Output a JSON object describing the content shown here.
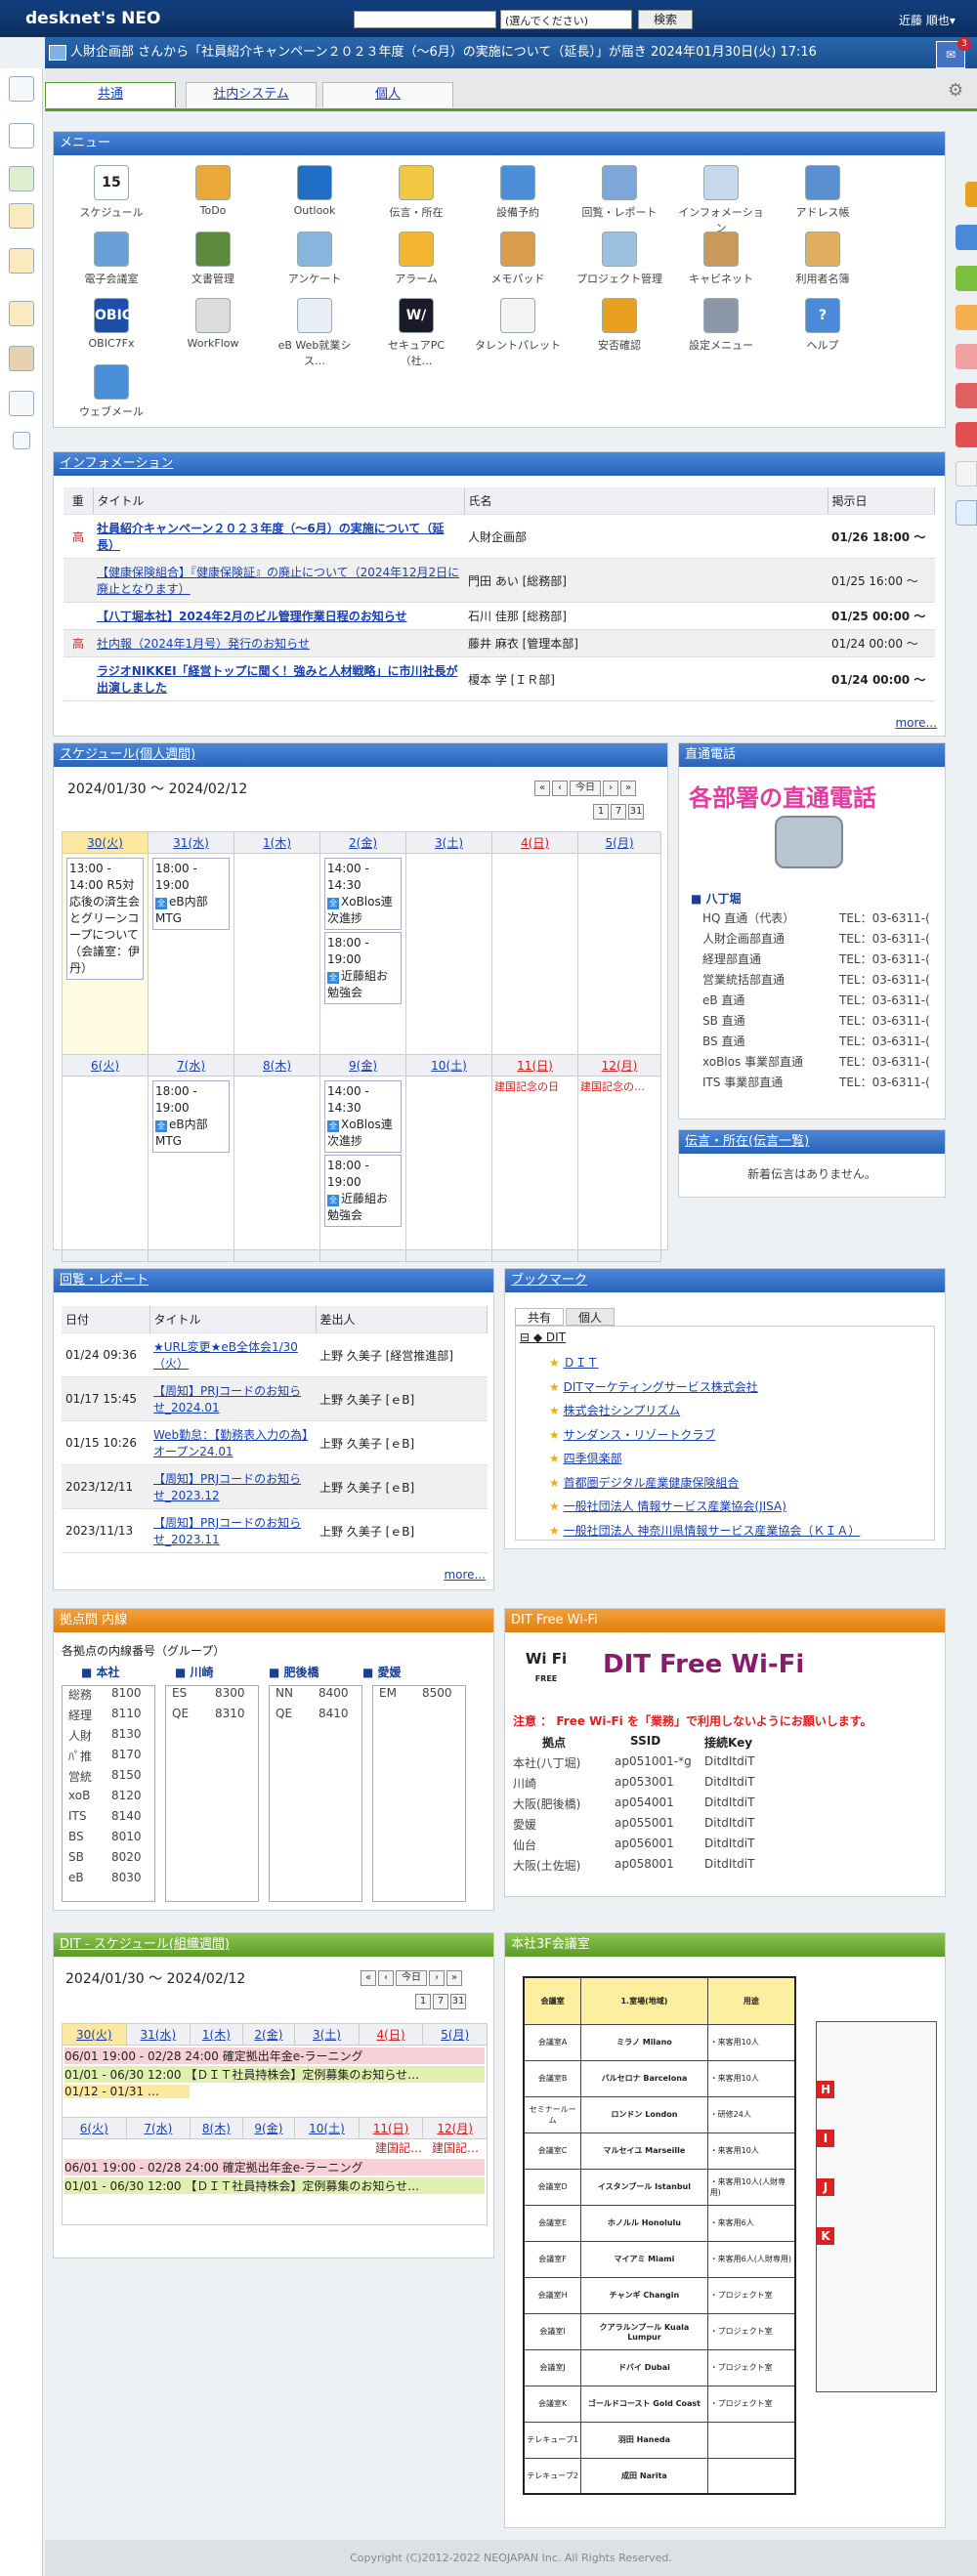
{
  "header": {
    "logo": "desknet's NEO",
    "select": "(選んでください)",
    "search": "検索",
    "user": "近藤 順也▾",
    "notice": "人財企画部 さんから「社員紹介キャンペーン２０２３年度（～6月）の実施について（延長）」が届き 2024年01月30日(火) 17:16",
    "badge": "3"
  },
  "tabs": [
    "共通",
    "社内システム",
    "個人"
  ],
  "menu": {
    "title": "メニュー",
    "items": [
      {
        "label": "スケジュール",
        "color": "#ffffff",
        "extra": "15"
      },
      {
        "label": "ToDo",
        "color": "#e8a93a"
      },
      {
        "label": "Outlook",
        "color": "#1f6fc7"
      },
      {
        "label": "伝言・所在",
        "color": "#f2c744"
      },
      {
        "label": "設備予約",
        "color": "#4c8fd8"
      },
      {
        "label": "回覧・レポート",
        "color": "#7ea6d8"
      },
      {
        "label": "インフォメーション",
        "color": "#c8d8ec"
      },
      {
        "label": "アドレス帳",
        "color": "#5a8fd0"
      },
      {
        "label": "電子会議室",
        "color": "#6aa0d8"
      },
      {
        "label": "文書管理",
        "color": "#5a8a3a"
      },
      {
        "label": "アンケート",
        "color": "#8ab4e0"
      },
      {
        "label": "アラーム",
        "color": "#f2b632"
      },
      {
        "label": "メモパッド",
        "color": "#d89c4a"
      },
      {
        "label": "プロジェクト管理",
        "color": "#9ec0e0"
      },
      {
        "label": "キャビネット",
        "color": "#c89a5a"
      },
      {
        "label": "利用者名簿",
        "color": "#e0b060"
      },
      {
        "label": "OBIC7Fx",
        "color": "#1e4fa8",
        "extra": "OBIC7"
      },
      {
        "label": "WorkFlow",
        "color": "#dddddd"
      },
      {
        "label": "eB Web就業シス…",
        "color": "#e8eef6"
      },
      {
        "label": "セキュアPC（社…",
        "color": "#1a1a2a",
        "extra": "W/"
      },
      {
        "label": "タレントパレット",
        "color": "#f4f4f4"
      },
      {
        "label": "安否確認",
        "color": "#e8a020"
      },
      {
        "label": "設定メニュー",
        "color": "#8a98a8"
      },
      {
        "label": "ヘルプ",
        "color": "#4a8ad8",
        "extra": "?"
      },
      {
        "label": "ウェブメール",
        "color": "#4a90d8"
      }
    ]
  },
  "info": {
    "title": "インフォメーション",
    "cols": [
      "重",
      "タイトル",
      "氏名",
      "掲示日"
    ],
    "rows": [
      {
        "p": "高",
        "t": "社員紹介キャンペーン２０２３年度（～6月）の実施について（延長）",
        "n": "人財企画部",
        "d": "01/26 18:00 ～",
        "bold": true
      },
      {
        "p": "",
        "t": "【健康保険組合】『健康保険証』の廃止について（2024年12月2日に廃止となります）",
        "n": "門田 あい [総務部]",
        "d": "01/25 16:00 ～",
        "bold": false
      },
      {
        "p": "",
        "t": "【八丁堀本社】2024年2月のビル管理作業日程のお知らせ",
        "n": "石川 佳那 [総務部]",
        "d": "01/25 00:00 ～",
        "bold": true
      },
      {
        "p": "高",
        "t": "社内報（2024年1月号）発行のお知らせ",
        "n": "藤井 麻衣 [管理本部]",
        "d": "01/24 00:00 ～",
        "bold": false
      },
      {
        "p": "",
        "t": "ラジオNIKKEI「経営トップに聞く！強みと人材戦略」に市川社長が出演しました",
        "n": "榎本 学 [ＩＲ部]",
        "d": "01/24 00:00 ～",
        "bold": true
      }
    ],
    "more": "more..."
  },
  "sched": {
    "title": "スケジュール(個人週間)",
    "range": "2024/01/30 ～ 2024/02/12",
    "today": "今日",
    "w1": [
      "30(火)",
      "31(水)",
      "1(木)",
      "2(金)",
      "3(土)",
      "4(日)",
      "5(月)"
    ],
    "w2": [
      "6(火)",
      "7(水)",
      "8(木)",
      "9(金)",
      "10(土)",
      "11(日)",
      "12(月)"
    ],
    "e1a": "13:00 - 14:00 R5対応後の済生会とグリーンコープについて（会議室：伊丹）",
    "e1b": "18:00 - 19:00",
    "e1b2": "eB内部MTG",
    "e1c": "14:00 - 14:30",
    "e1c2": "XoBlos連次進捗",
    "e1d": "18:00 - 19:00",
    "e1d2": "近藤組お勉強会",
    "e2b": "18:00 - 19:00",
    "e2b2": "eB内部MTG",
    "e2c": "14:00 - 14:30",
    "e2c2": "XoBlos連次進捗",
    "e2d": "18:00 - 19:00",
    "e2d2": "近藤組お勉強会",
    "h1": "建国記念の日",
    "h2": "建国記念の…"
  },
  "phone": {
    "title": "直通電話",
    "head": "各部署の直通電話",
    "site": "■ 八丁堀",
    "rows": [
      [
        "HQ 直通（代表）",
        "TEL：03-6311-("
      ],
      [
        "人財企画部直通",
        "TEL：03-6311-("
      ],
      [
        "経理部直通",
        "TEL：03-6311-("
      ],
      [
        "営業統括部直通",
        "TEL：03-6311-("
      ],
      [
        "eB 直通",
        "TEL：03-6311-("
      ],
      [
        "SB 直通",
        "TEL：03-6311-("
      ],
      [
        "BS 直通",
        "TEL：03-6311-("
      ],
      [
        "xoBlos 事業部直通",
        "TEL：03-6311-("
      ],
      [
        "ITS 事業部直通",
        "TEL：03-6311-("
      ]
    ]
  },
  "msg": {
    "title": "伝言・所在(伝言一覧)",
    "body": "新着伝言はありません。"
  },
  "circ": {
    "title": "回覧・レポート",
    "cols": [
      "日付",
      "タイトル",
      "差出人"
    ],
    "rows": [
      [
        "01/24 09:36",
        "★URL変更★eB全体会1/30（火）",
        "上野 久美子 [経営推進部]"
      ],
      [
        "01/17 15:45",
        "【周知】PRJコードのお知らせ_2024.01",
        "上野 久美子 [ｅB]"
      ],
      [
        "01/15 10:26",
        "Web勤怠：【勤務表入力の為】オープン24.01",
        "上野 久美子 [ｅB]"
      ],
      [
        "2023/12/11",
        "【周知】PRJコードのお知らせ_2023.12",
        "上野 久美子 [ｅB]"
      ],
      [
        "2023/11/13",
        "【周知】PRJコードのお知らせ_2023.11",
        "上野 久美子 [ｅB]"
      ]
    ],
    "more": "more..."
  },
  "bm": {
    "title": "ブックマーク",
    "tabs": [
      "共有",
      "個人"
    ],
    "root": "DIT",
    "items": [
      "ＤＩＴ",
      "DITマーケティングサービス株式会社",
      "株式会社シンプリズム",
      "サンダンス・リゾートクラブ",
      "四季倶楽部",
      "首都圏デジタル産業健康保険組合",
      "一般社団法人 情報サービス産業協会(JISA)",
      "一般社団法人 神奈川県情報サービス産業協会（ＫＩＡ）"
    ]
  },
  "ext": {
    "title": "拠点間 内線",
    "sub": "各拠点の内線番号（グループ）",
    "sites": [
      "■ 本社",
      "■ 川崎",
      "■ 肥後橋",
      "■ 愛媛"
    ],
    "c1": [
      [
        "総務",
        "8100"
      ],
      [
        "経理",
        "8110"
      ],
      [
        "人財",
        "8130"
      ],
      [
        "ﾊﾟ推",
        "8170"
      ],
      [
        "営統",
        "8150"
      ],
      [
        "xoB",
        "8120"
      ],
      [
        "ITS",
        "8140"
      ],
      [
        "BS",
        "8010"
      ],
      [
        "SB",
        "8020"
      ],
      [
        "eB",
        "8030"
      ]
    ],
    "c2": [
      [
        "ES",
        "8300"
      ],
      [
        "QE",
        "8310"
      ]
    ],
    "c3": [
      [
        "NN",
        "8400"
      ],
      [
        "QE",
        "8410"
      ]
    ],
    "c4": [
      [
        "EM",
        "8500"
      ]
    ]
  },
  "wifi": {
    "title": "DIT Free Wi-Fi",
    "head": "DIT Free Wi-Fi",
    "logo": "Wi Fi",
    "logo2": "FREE",
    "warn": "注意 ： Free Wi-Fi を「業務」で利用しないようにお願いします。",
    "cols": [
      "拠点",
      "SSID",
      "接続Key"
    ],
    "rows": [
      [
        "本社(八丁堀)",
        "ap051001-*g",
        "DitdItdiT"
      ],
      [
        "川崎",
        "ap053001",
        "DitdItdiT"
      ],
      [
        "大阪(肥後橋)",
        "ap054001",
        "DitdItdiT"
      ],
      [
        "愛媛",
        "ap055001",
        "DitdItdiT"
      ],
      [
        "仙台",
        "ap056001",
        "DitdItdiT"
      ],
      [
        "大阪(土佐堀)",
        "ap058001",
        "DitdItdiT"
      ]
    ]
  },
  "org": {
    "title": "DIT - スケジュール(組織週間)",
    "range": "2024/01/30 ～ 2024/02/12",
    "today": "今日",
    "w1": [
      "30(火)",
      "31(水)",
      "1(木)",
      "2(金)",
      "3(土)",
      "4(日)",
      "5(月)"
    ],
    "w2": [
      "6(火)",
      "7(水)",
      "8(木)",
      "9(金)",
      "10(土)",
      "11(日)",
      "12(月)"
    ],
    "b1": "06/01 19:00 - 02/28 24:00 確定拠出年金e-ラーニング",
    "b2": "01/01 - 06/30 12:00 【ＤＩＴ社員持株会】定例募集のお知らせ…",
    "b3": "01/12 - 01/31 …",
    "h1": "建国記…",
    "h2": "建国記…"
  },
  "room": {
    "title": "本社3F会議室",
    "cols": [
      "会議室",
      "1.室場(地域)",
      "用途"
    ],
    "rows": [
      [
        "会議室A",
        "ミラノ Milano",
        "・来客用10人"
      ],
      [
        "会議室B",
        "バルセロナ Barcelona",
        "・来客用10人"
      ],
      [
        "セミナールーム",
        "ロンドン London",
        "・研修24人"
      ],
      [
        "会議室C",
        "マルセイユ Marseille",
        "・来客用10人"
      ],
      [
        "会議室D",
        "イスタンブール Istanbul",
        "・来客用10人(人財専用)"
      ],
      [
        "会議室E",
        "ホノルル Honolulu",
        "・来客用6人"
      ],
      [
        "会議室F",
        "マイアミ Miami",
        "・来客用6人(人財専用)"
      ],
      [
        "会議室H",
        "チャンギ Changin",
        "・プロジェクト室"
      ],
      [
        "会議室I",
        "クアラルンプール Kuala Lumpur",
        "・プロジェクト室"
      ],
      [
        "会議室J",
        "ドバイ Dubai",
        "・プロジェクト室"
      ],
      [
        "会議室K",
        "ゴールドコースト Gold Coast",
        "・プロジェクト室"
      ],
      [
        "テレキューブ1",
        "羽田 Haneda",
        ""
      ],
      [
        "テレキューブ2",
        "成田 Narita",
        ""
      ]
    ],
    "map": [
      "H",
      "I",
      "J",
      "K"
    ]
  },
  "footer": "Copyright (C)2012-2022 NEOJAPAN Inc. All Rights Reserved."
}
